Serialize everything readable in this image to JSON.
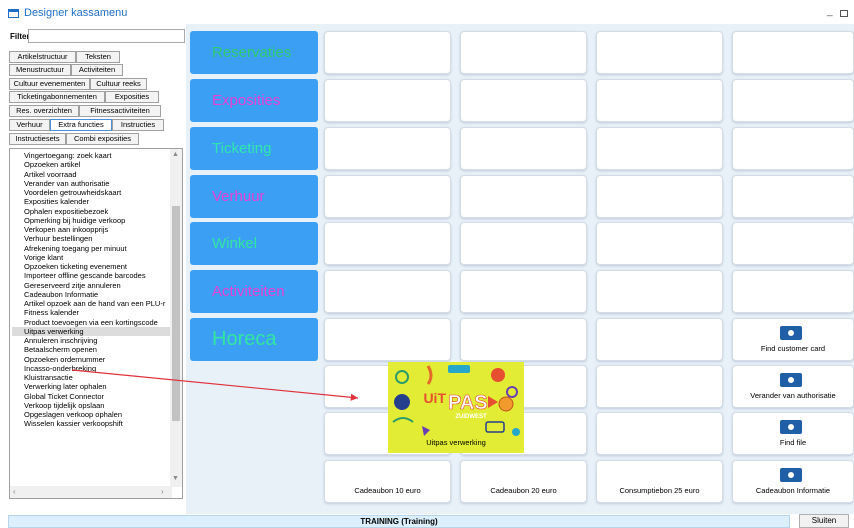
{
  "window": {
    "title": "Designer kassamenu",
    "min_glyph": "_",
    "colors": {
      "title": "#1e6fc8",
      "category_bg": "#3ba0f4",
      "status_bg": "#dcefff",
      "arrow": "#e0323a"
    }
  },
  "filter": {
    "label": "Filter:",
    "value": "",
    "placeholder": ""
  },
  "tabs": [
    {
      "label": "Artikelstructuur",
      "active": false
    },
    {
      "label": "Teksten",
      "active": false
    },
    {
      "label": "Menustructuur",
      "active": false
    },
    {
      "label": "Activiteiten",
      "active": false
    },
    {
      "label": "Cultuur evenementen",
      "active": false
    },
    {
      "label": "Cultuur reeks",
      "active": false
    },
    {
      "label": "Ticketingabonnementen",
      "active": false
    },
    {
      "label": "Exposities",
      "active": false
    },
    {
      "label": "Res. overzichten",
      "active": false
    },
    {
      "label": "Fitnessactiviteiten",
      "active": false
    },
    {
      "label": "Verhuur",
      "active": false
    },
    {
      "label": "Extra functies",
      "active": true
    },
    {
      "label": "Instructies",
      "active": false
    },
    {
      "label": "Instructiesets",
      "active": false
    },
    {
      "label": "Combi exposities",
      "active": false
    }
  ],
  "functions_list": [
    "Vingertoegang: zoek kaart",
    "Opzoeken artikel",
    "Artikel voorraad",
    "Verander van authorisatie",
    "Voordelen getrouwheidskaart",
    "Exposities kalender",
    "Ophalen expositiebezoek",
    "Opmerking bij huidige verkoop",
    "Verkopen aan inkoopprijs",
    "Verhuur bestellingen",
    "Afrekening toegang per minuut",
    "Vorige klant",
    "Opzoeken ticketing evenement",
    "Importeer offline gescande barcodes",
    "Gereserveerd zitje annuleren",
    "Cadeaubon Informatie",
    "Artikel opzoek aan de hand van een PLU-r",
    "Fitness kalender",
    "Product toevoegen via een kortingscode",
    "Uitpas verwerking",
    "Annuleren inschrijving",
    "Betaalscherm openen",
    "Opzoeken ordernummer",
    "Incasso-onderbreking",
    "Kluistransactie",
    "Verwerking later ophalen",
    "Global Ticket Connector",
    "Verkoop tijdelijk opslaan",
    "Opgeslagen verkoop ophalen",
    "Wisselen kassier verkoopshift"
  ],
  "selected_function": "Uitpas verwerking",
  "categories": [
    {
      "label": "Reservaties",
      "color": "#2ecc71"
    },
    {
      "label": "Exposities",
      "color": "#e83fd6"
    },
    {
      "label": "Ticketing",
      "color": "#2ee6b0"
    },
    {
      "label": "Verhuur",
      "color": "#e83fd6"
    },
    {
      "label": "Winkel",
      "color": "#33e6a0"
    },
    {
      "label": "Activiteiten",
      "color": "#e83fd6"
    },
    {
      "label": "Horeca",
      "color": "#33e6a0"
    }
  ],
  "buttons": [
    {
      "label": "Find customer card",
      "icon": "id-card-icon"
    },
    {
      "label": "Uitpas verwerking",
      "icon": "uitpas-logo-image"
    },
    {
      "label": "Verander van authorisatie",
      "icon": "key-icon"
    },
    {
      "label": "Find file",
      "icon": "folder-search-icon"
    },
    {
      "label": "Cadeaubon 10 euro",
      "icon": ""
    },
    {
      "label": "Cadeaubon 20  euro",
      "icon": ""
    },
    {
      "label": "Consumptiebon 25 euro",
      "icon": ""
    },
    {
      "label": "Cadeaubon Informatie",
      "icon": "gift-card-icon"
    }
  ],
  "uitpas_logo": {
    "brand": "UiT",
    "word": "PAS",
    "region": "ZUIDWEST"
  },
  "status": {
    "text": "TRAINING (Training)"
  },
  "close_button": {
    "label": "Sluiten"
  }
}
